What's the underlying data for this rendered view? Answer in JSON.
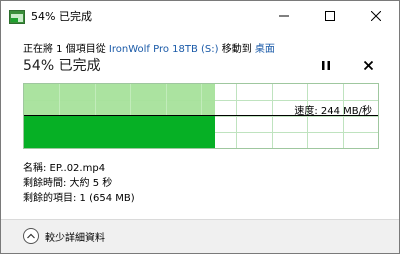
{
  "window": {
    "title": "54% 已完成",
    "minimize_icon": "minimize-icon",
    "maximize_icon": "maximize-icon",
    "close_icon": "close-icon"
  },
  "transfer": {
    "status_prefix": "正在將 1 個項目從 ",
    "source": "IronWolf Pro 18TB (S:)",
    "status_middle": " 移動到 ",
    "destination": "桌面",
    "percent_title": "54% 已完成",
    "progress_fraction": 0.54,
    "speed_label": "速度: 244 MB/秒",
    "pause_icon": "pause-icon",
    "cancel_icon": "cancel-icon"
  },
  "details": {
    "name_line": "名稱: EP..02.mp4",
    "time_remaining_line": "剩餘時間: 大約 5 秒",
    "items_remaining_line": "剩餘的項目: 1 (654 MB)"
  },
  "footer": {
    "more_details_label": "較少詳細資料",
    "chevron_icon": "chevron-up-icon"
  },
  "colors": {
    "progress_fill": "#06b025",
    "progress_bg": "#a6e29b",
    "grid_line": "#bfe3bf",
    "link": "#1a5aa8"
  }
}
